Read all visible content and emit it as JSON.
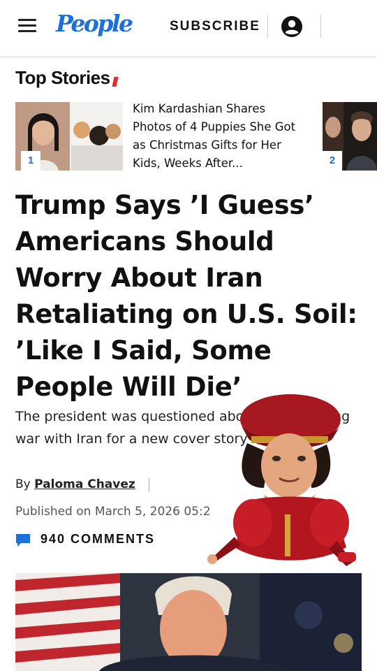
{
  "header": {
    "logo": "People",
    "subscribe_label": "SUBSCRIBE",
    "icons": {
      "menu": "hamburger-menu-icon",
      "account": "account-icon"
    },
    "brand_color": "#1d6fdc"
  },
  "top_stories": {
    "title": "Top Stories",
    "highlight_color": "#f4e500",
    "accent_color": "#e8282b",
    "items": [
      {
        "rank": "1",
        "headline": "Kim Kardashian Shares Photos of 4 Puppies She Got as Christmas Gifts for Her Kids, Weeks After..."
      },
      {
        "rank": "2",
        "headline": ""
      }
    ]
  },
  "article": {
    "headline": "Trump Says ’I Guess’ Americans Should Worry About Iran Retaliating on U.S. Soil: ’Like I Said, Some People Will Die’",
    "dek": "The president was questioned about the unfolding war with Iran for a new cover story",
    "byline_prefix": "By",
    "author": "Paloma Chavez",
    "published": "Published on March 5, 2026 05:2",
    "comments_label": "940 COMMENTS",
    "comment_icon": "speech-bubble-icon"
  }
}
